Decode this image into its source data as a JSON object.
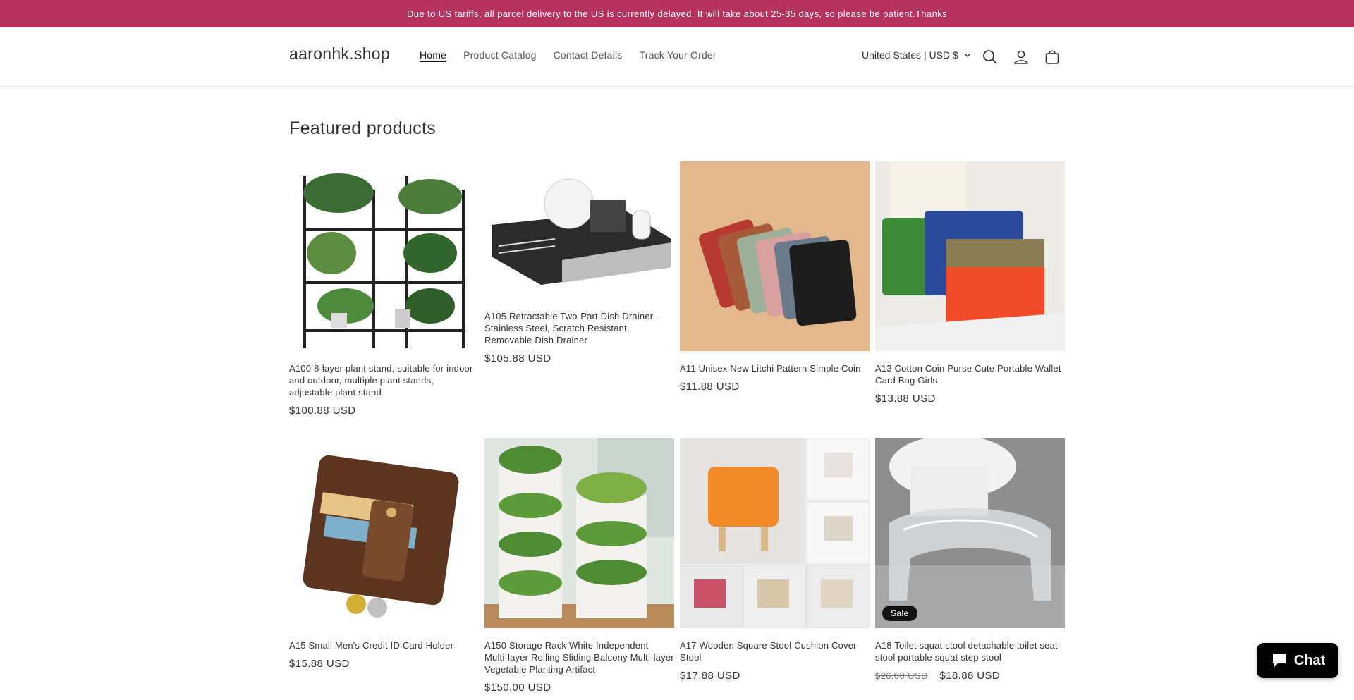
{
  "announcement": "Due to US tariffs, all parcel delivery to the US is currently delayed. It will take about 25-35 days, so please be patient.Thanks",
  "header": {
    "logo": "aaronhk.shop",
    "nav": [
      "Home",
      "Product Catalog",
      "Contact Details",
      "Track Your Order"
    ],
    "locale": "United States | USD $",
    "icons": [
      "search-icon",
      "account-icon",
      "cart-icon"
    ]
  },
  "featured": {
    "title": "Featured products",
    "products": [
      {
        "name": "A100 8-layer plant stand, suitable for indoor and outdoor, multiple plant stands, adjustable plant stand",
        "price": "$100.88 USD"
      },
      {
        "name": "A105 Retractable Two-Part Dish Drainer - Stainless Steel, Scratch Resistant, Removable Dish Drainer",
        "price": "$105.88 USD"
      },
      {
        "name": "A11 Unisex New Litchi Pattern Simple Coin",
        "price": "$11.88 USD"
      },
      {
        "name": "A13 Cotton Coin Purse Cute Portable Wallet Card Bag Girls",
        "price": "$13.88 USD"
      },
      {
        "name": "A15 Small Men's Credit ID Card Holder",
        "price": "$15.88 USD"
      },
      {
        "name": "A150 Storage Rack White Independent Multi-layer Rolling Sliding Balcony Multi-layer Vegetable Planting Artifact",
        "price": "$150.00 USD"
      },
      {
        "name": "A17 Wooden Square Stool Cushion Cover Stool",
        "price": "$17.88 USD"
      },
      {
        "name": "A18 Toilet squat stool detachable toilet seat stool portable squat step stool",
        "old_price": "$26.00 USD",
        "price": "$18.88 USD",
        "badge": "Sale"
      }
    ]
  },
  "chat": {
    "label": "Chat"
  },
  "colors": {
    "announcement_bg": "#b83260",
    "chat_bg": "#000000",
    "badge_bg": "#121212"
  }
}
